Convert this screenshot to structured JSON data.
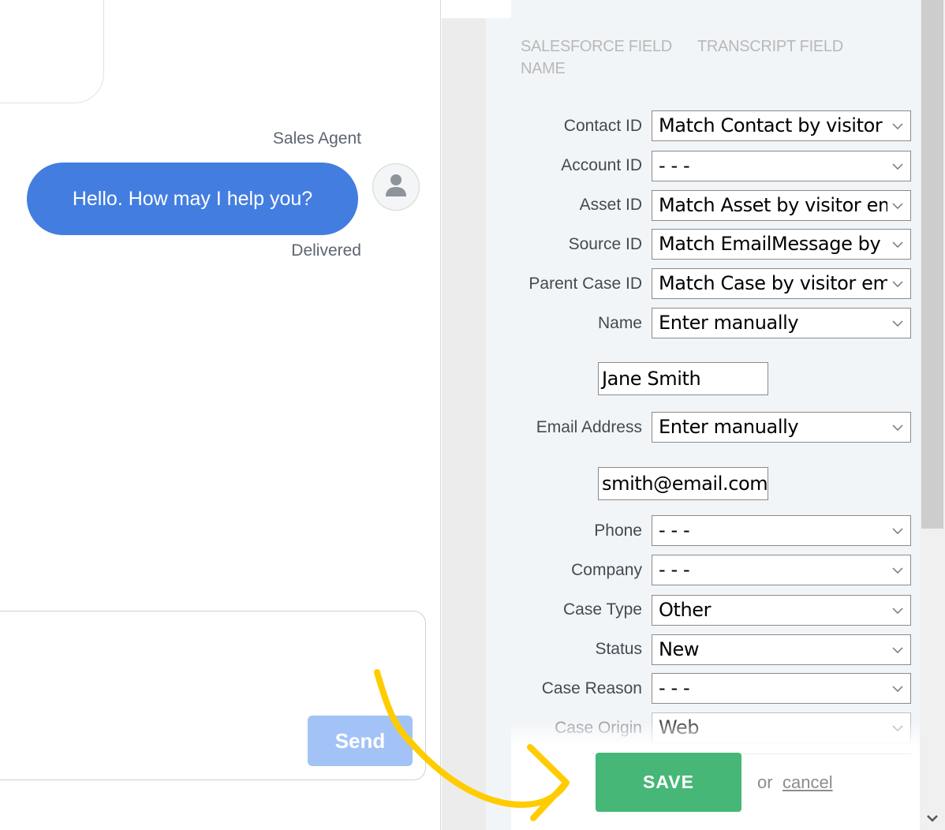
{
  "chat": {
    "sender_name": "Sales Agent",
    "message": "Hello. How may I help you?",
    "delivery_status": "Delivered",
    "composer_placeholder": "",
    "send_label": "Send",
    "avatar_icon": "user-icon"
  },
  "mapping_form": {
    "columns": {
      "salesforce_field": "SALESFORCE FIELD NAME",
      "transcript_field": "TRANSCRIPT FIELD"
    },
    "rows": [
      {
        "label": "Contact ID",
        "value": "Match Contact by visitor"
      },
      {
        "label": "Account ID",
        "value": "- - -"
      },
      {
        "label": "Asset ID",
        "value": "Match Asset by visitor em"
      },
      {
        "label": "Source ID",
        "value": "Match EmailMessage by"
      },
      {
        "label": "Parent Case ID",
        "value": "Match Case by visitor em"
      },
      {
        "label": "Name",
        "value": "Enter manually",
        "manual_value": "Jane Smith"
      },
      {
        "label": "Email Address",
        "value": "Enter manually",
        "manual_value": "smith@email.com"
      },
      {
        "label": "Phone",
        "value": "- - -"
      },
      {
        "label": "Company",
        "value": "- - -"
      },
      {
        "label": "Case Type",
        "value": "Other"
      },
      {
        "label": "Status",
        "value": "New"
      },
      {
        "label": "Case Reason",
        "value": "- - -"
      },
      {
        "label": "Case Origin",
        "value": "Web"
      }
    ],
    "save_label": "SAVE",
    "or_text": "or",
    "cancel_label": "cancel"
  },
  "colors": {
    "bubble": "#437de0",
    "send_disabled": "#a3c3f7",
    "save": "#47b778",
    "annotation_arrow": "#ffcc00",
    "form_bg": "#f2f5f8"
  }
}
